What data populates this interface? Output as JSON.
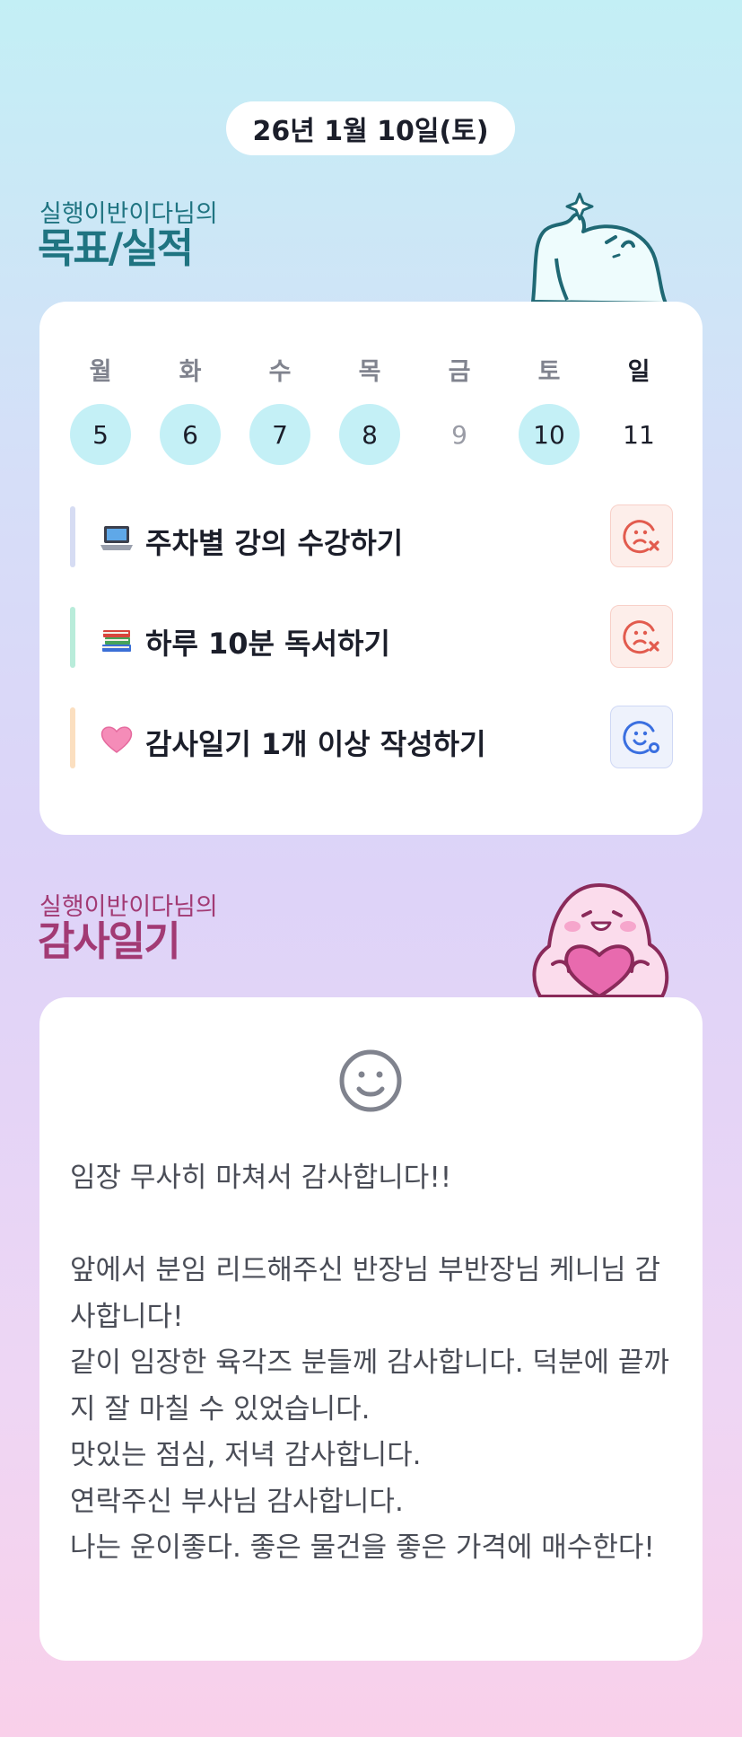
{
  "header": {
    "date": "26년 1월 10일(토)"
  },
  "goals_section": {
    "subtitle": "실행이반이다님의",
    "title": "목표/실적"
  },
  "week": [
    {
      "name": "월",
      "num": "5",
      "done": true
    },
    {
      "name": "화",
      "num": "6",
      "done": true
    },
    {
      "name": "수",
      "num": "7",
      "done": true
    },
    {
      "name": "목",
      "num": "8",
      "done": true
    },
    {
      "name": "금",
      "num": "9",
      "done": false
    },
    {
      "name": "토",
      "num": "10",
      "done": true
    },
    {
      "name": "일",
      "num": "11",
      "done": false
    }
  ],
  "goals": [
    {
      "icon": "laptop-icon",
      "label": "주차별 강의 수강하기",
      "status": "fail",
      "status_icon": "sad-face-x-icon",
      "accent": "#d6dcf3"
    },
    {
      "icon": "books-icon",
      "label": "하루 10분 독서하기",
      "status": "fail",
      "status_icon": "sad-face-x-icon",
      "accent": "#b9ecda"
    },
    {
      "icon": "pink-heart-icon",
      "label": "감사일기 1개 이상 작성하기",
      "status": "pass",
      "status_icon": "happy-face-o-icon",
      "accent": "#fbdfc0"
    }
  ],
  "diary_section": {
    "subtitle": "실행이반이다님의",
    "title": "감사일기"
  },
  "diary": {
    "mood_icon": "smiley-face-icon",
    "text": "임장 무사히 마쳐서 감사합니다!!\n\n앞에서 분임 리드해주신 반장님 부반장님 케니님 감사합니다!\n같이 임장한 육각즈 분들께 감사합니다. 덕분에 끝까지 잘 마칠 수 있었습니다.\n맛있는 점심, 저녁 감사합니다.\n연락주신 부사님 감사합니다.\n나는 운이좋다. 좋은 물건을 좋은 가격에 매수한다!"
  },
  "colors": {
    "teal_title": "#1f7481",
    "plum_title": "#a23a74",
    "done_day": "#c4f0f6",
    "fail_red": "#e25b4e",
    "pass_blue": "#3a6fe0"
  }
}
